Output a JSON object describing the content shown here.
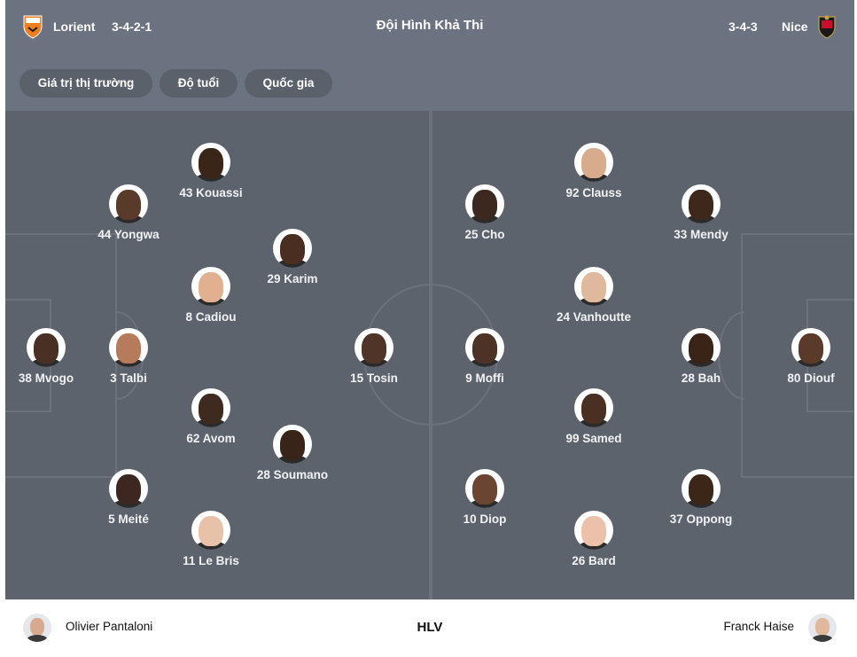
{
  "header": {
    "home_team": "Lorient",
    "home_formation": "3-4-2-1",
    "title": "Đội Hình Khả Thi",
    "away_formation": "3-4-3",
    "away_team": "Nice",
    "home_crest_icon": "lorient-crest-icon",
    "away_crest_icon": "nice-crest-icon",
    "home_color": "#f07d1e",
    "away_color": "#c8102e"
  },
  "filters": [
    {
      "label": "Giá trị thị trường"
    },
    {
      "label": "Độ tuổi"
    },
    {
      "label": "Quốc gia"
    }
  ],
  "home_players": [
    {
      "name": "38 Mvogo",
      "skin": "#4a3024"
    },
    {
      "name": "44 Yongwa",
      "skin": "#5a3a2a"
    },
    {
      "name": "3 Talbi",
      "skin": "#b57b5a"
    },
    {
      "name": "5 Meité",
      "skin": "#3c2820"
    },
    {
      "name": "43 Kouassi",
      "skin": "#3a2519"
    },
    {
      "name": "8 Cadiou",
      "skin": "#e0b090"
    },
    {
      "name": "62 Avom",
      "skin": "#3e2a1e"
    },
    {
      "name": "11 Le Bris",
      "skin": "#e8c2a8"
    },
    {
      "name": "29 Karim",
      "skin": "#4a2e22"
    },
    {
      "name": "28 Soumano",
      "skin": "#382419"
    },
    {
      "name": "15 Tosin",
      "skin": "#4f3427"
    }
  ],
  "away_players": [
    {
      "name": "25 Cho",
      "skin": "#3c281e"
    },
    {
      "name": "9 Moffi",
      "skin": "#4d3226"
    },
    {
      "name": "10 Diop",
      "skin": "#6a4532"
    },
    {
      "name": "92 Clauss",
      "skin": "#d8ab8c"
    },
    {
      "name": "24 Vanhoutte",
      "skin": "#e0b99c"
    },
    {
      "name": "99 Samed",
      "skin": "#4a3022"
    },
    {
      "name": "26 Bard",
      "skin": "#ecc1aa"
    },
    {
      "name": "33 Mendy",
      "skin": "#3e281c"
    },
    {
      "name": "28 Bah",
      "skin": "#3a2418"
    },
    {
      "name": "37 Oppong",
      "skin": "#3c2618"
    },
    {
      "name": "80 Diouf",
      "skin": "#5a3a28"
    }
  ],
  "footer": {
    "home_coach": "Olivier Pantaloni",
    "label": "HLV",
    "away_coach": "Franck Haise"
  }
}
